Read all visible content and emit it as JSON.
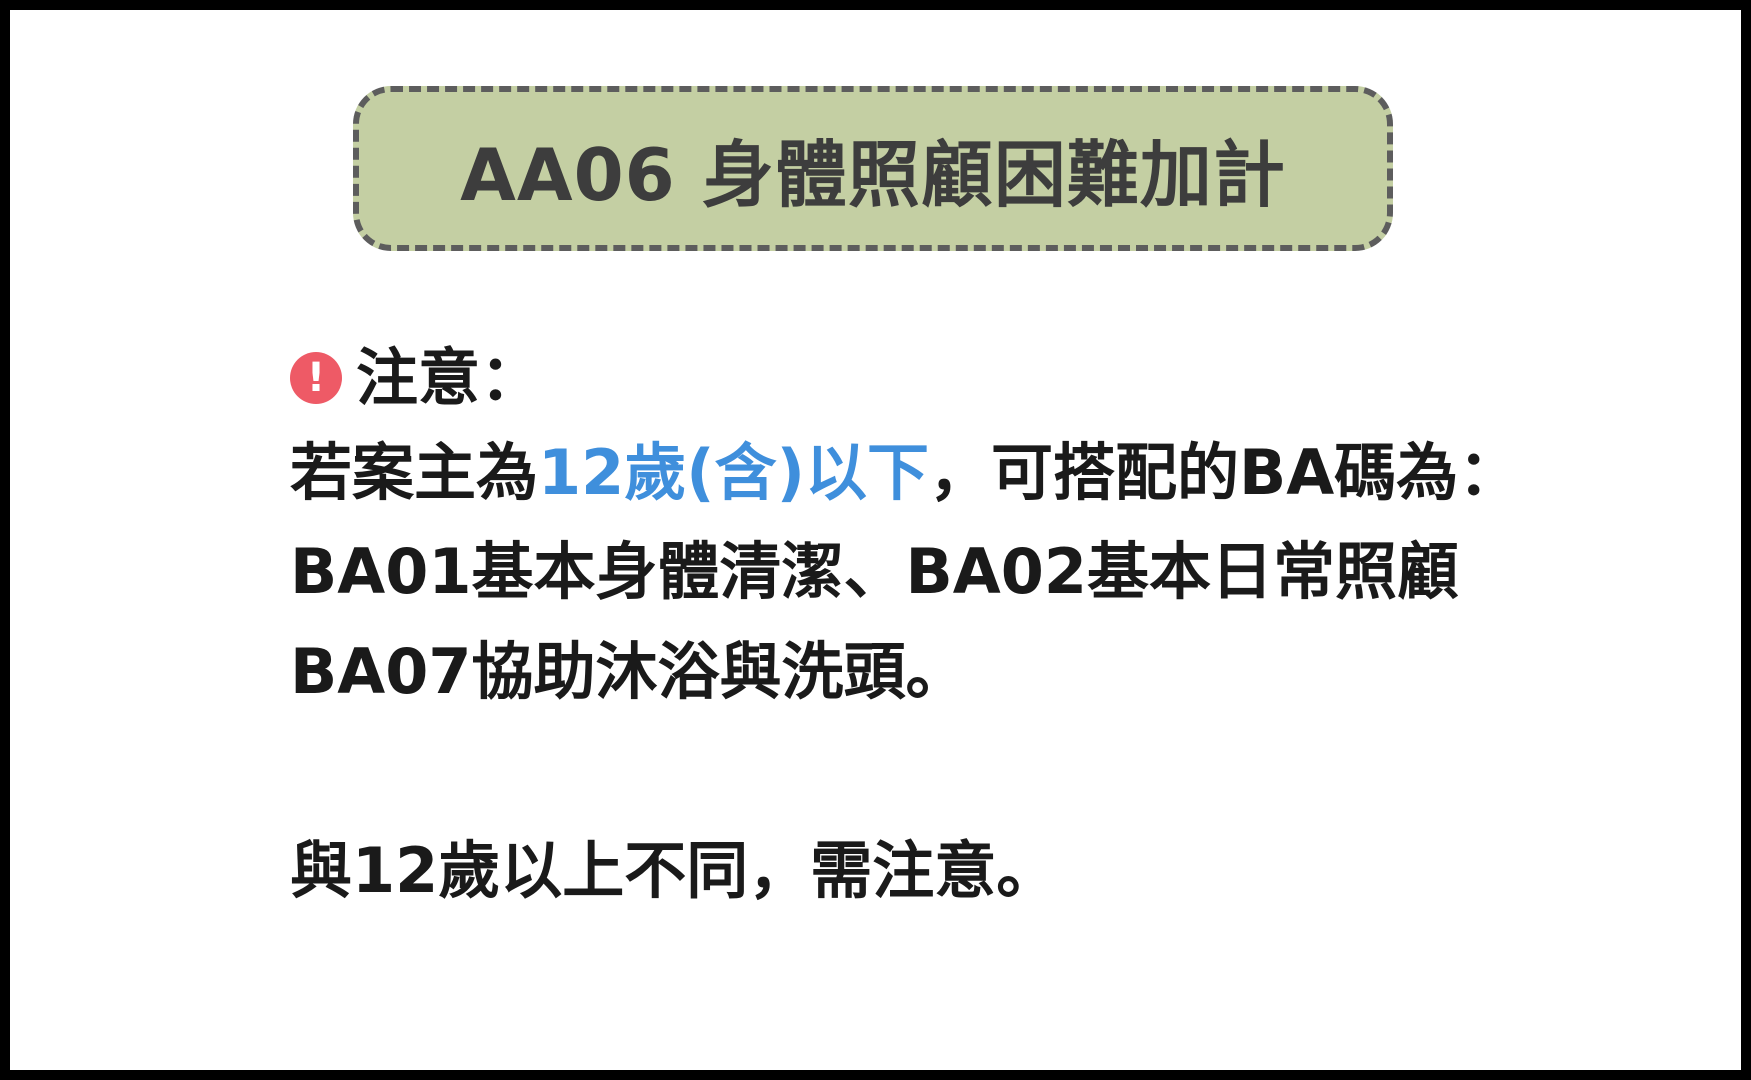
{
  "title": "AA06 身體照顧困難加計",
  "notice": {
    "icon": "exclamation-circle-icon",
    "icon_glyph": "!",
    "icon_color": "#ee5a66",
    "label": "注意："
  },
  "body": {
    "line1_prefix": "若案主為",
    "line1_highlight": "12歲(含)以下",
    "line1_suffix": "，可搭配的BA碼為：",
    "line2": "BA01基本身體清潔、BA02基本日常照顧",
    "line3": "BA07協助沐浴與洗頭。",
    "line4": "與12歲以上不同，需注意。"
  },
  "colors": {
    "title_box_bg": "#c4cfa3",
    "title_box_border": "#5d5d5d",
    "highlight": "#3f8fdc",
    "text": "#1a1a1a"
  }
}
